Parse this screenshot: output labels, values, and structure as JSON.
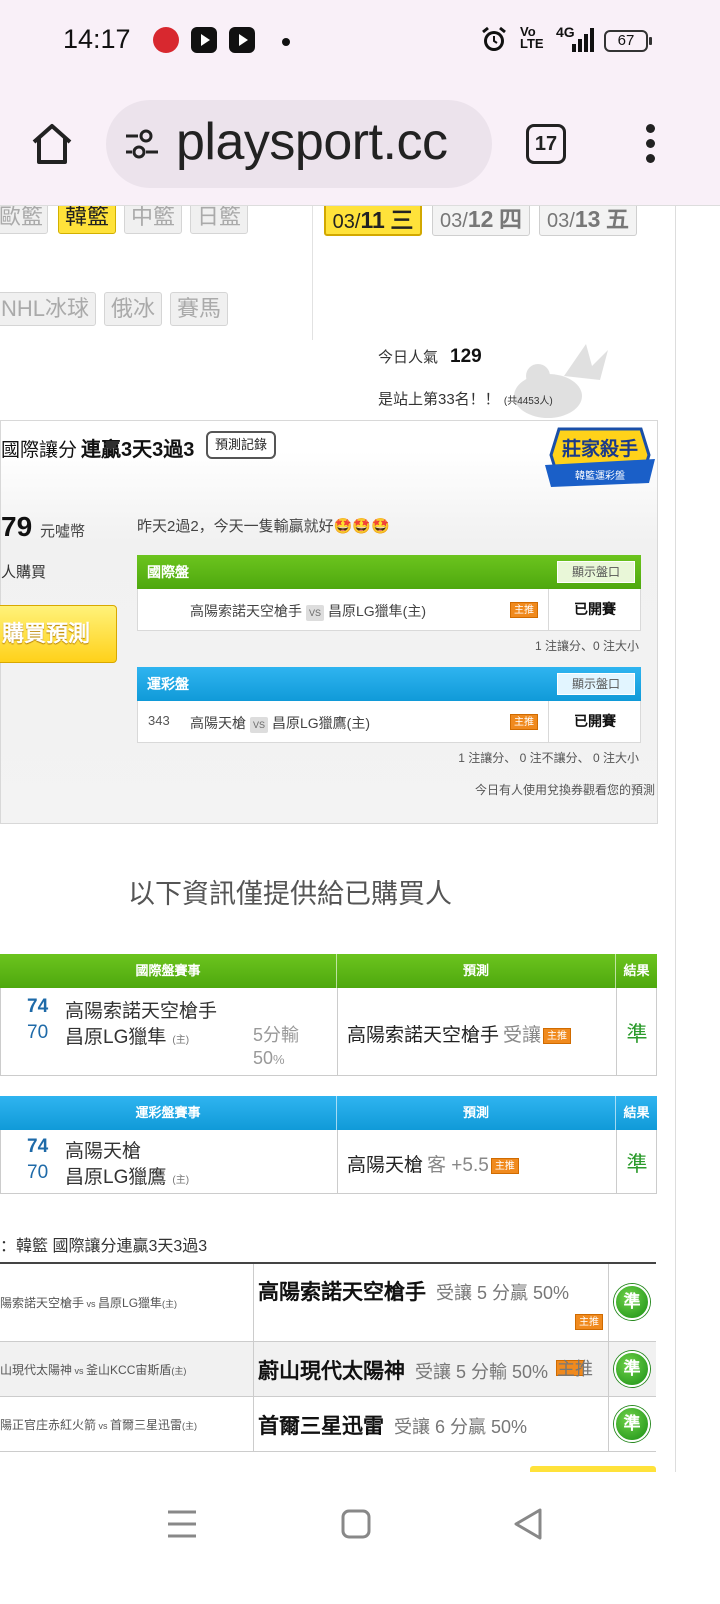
{
  "status_bar": {
    "time": "14:17",
    "net_volte": "Vo LTE",
    "net_signal": "4G",
    "battery": "67",
    "icons": [
      "app-icon",
      "youtube-icon",
      "youtube-icon",
      "notification-dot",
      "alarm-icon",
      "signal-icon",
      "battery-icon"
    ]
  },
  "browser": {
    "url": "playsport.cc",
    "tab_count": "17"
  },
  "sport_tabs": {
    "row1": [
      "歐籃",
      "韓籃",
      "中籃",
      "日籃"
    ],
    "row2": [
      "NHL冰球",
      "俄冰",
      "賽馬"
    ],
    "active": "韓籃"
  },
  "date_tabs": [
    {
      "mm": "03/",
      "dd": "11",
      "wd": "三",
      "active": true
    },
    {
      "mm": "03/",
      "dd": "12",
      "wd": "四",
      "active": false
    },
    {
      "mm": "03/",
      "dd": "13",
      "wd": "五",
      "active": false
    }
  ],
  "popularity": {
    "label": "今日人氣",
    "value": "129",
    "rank_text": "是站上第33名！！",
    "rank_total": "(共4453人)"
  },
  "pick": {
    "title_prefix": "國際讓分",
    "title_bold": "連贏3天3過3",
    "record_button": "預測記錄",
    "badge_top": "莊家殺手",
    "badge_bottom": "韓籃運彩盤",
    "price": "79",
    "price_unit": "元噓幣",
    "buyers_text": "人購買",
    "buy_button": "購買預測",
    "comment": "昨天2過2，今天一隻輸贏就好🤩🤩🤩",
    "intl": {
      "header": "國際盤",
      "show_button": "顯示盤口",
      "num": "",
      "away": "高陽索諾天空槍手",
      "home": "昌原LG獵隼(主)",
      "tag": "主推",
      "status": "已開賽",
      "note": "1 注讓分、0 注大小"
    },
    "sports_lottery": {
      "header": "運彩盤",
      "show_button": "顯示盤口",
      "num": "343",
      "away": "高陽天槍",
      "home": "昌原LG獵鷹(主)",
      "tag": "主推",
      "status": "已開賽",
      "note": "1 注讓分、 0 注不讓分、 0 注大小"
    },
    "voucher_note": "今日有人使用兌換券觀看您的預測"
  },
  "vs_label": "VS",
  "only_buyers_note": "以下資訊僅提供給已購買人",
  "result_intl": {
    "headers": [
      "國際盤賽事",
      "預測",
      "結果"
    ],
    "away_score": "74",
    "home_score": "70",
    "away": "高陽索諾天空槍手",
    "home": "昌原LG獵隼",
    "home_tag": "(主)",
    "spread": "5分輸",
    "spread_pct": "50",
    "pct_unit": "%",
    "pred_team": "高陽索諾天空槍手",
    "pred_type": "受讓",
    "tag": "主推",
    "result": "準"
  },
  "result_sports": {
    "headers": [
      "運彩盤賽事",
      "預測",
      "結果"
    ],
    "away_score": "74",
    "home_score": "70",
    "away": "高陽天槍",
    "home": "昌原LG獵鷹",
    "home_tag": "(主)",
    "pred_team": "高陽天槍",
    "pred_type": "客 +5.5",
    "tag": "主推",
    "result": "準"
  },
  "history": {
    "title": "：韓籃 國際讓分連贏3天3過3",
    "rows": [
      {
        "away": "陽索諾天空槍手",
        "home": "昌原LG獵隼",
        "home_tag": "(主)",
        "pick": "高陽索諾天空槍手",
        "detail": "受讓 5 分贏 50%",
        "tag": "主推",
        "result": "準"
      },
      {
        "away": "山現代太陽神",
        "home": "釜山KCC宙斯盾",
        "home_tag": "(主)",
        "pick": "蔚山現代太陽神",
        "detail": "受讓 5 分輸 50%",
        "tag": "主推",
        "result": "準"
      },
      {
        "away": "陽正官庄赤紅火箭",
        "home": "首爾三星迅雷",
        "home_tag": "(主)",
        "pick": "首爾三星迅雷",
        "detail": "受讓 6 分贏 50%",
        "tag": "",
        "result": "準"
      }
    ]
  },
  "colors": {
    "intl_green": "#5bb514",
    "lottery_blue": "#1ba3e4",
    "active_yellow": "#ffe23a",
    "tag_orange": "#f08a1e",
    "win_green": "#2a9a2a"
  }
}
